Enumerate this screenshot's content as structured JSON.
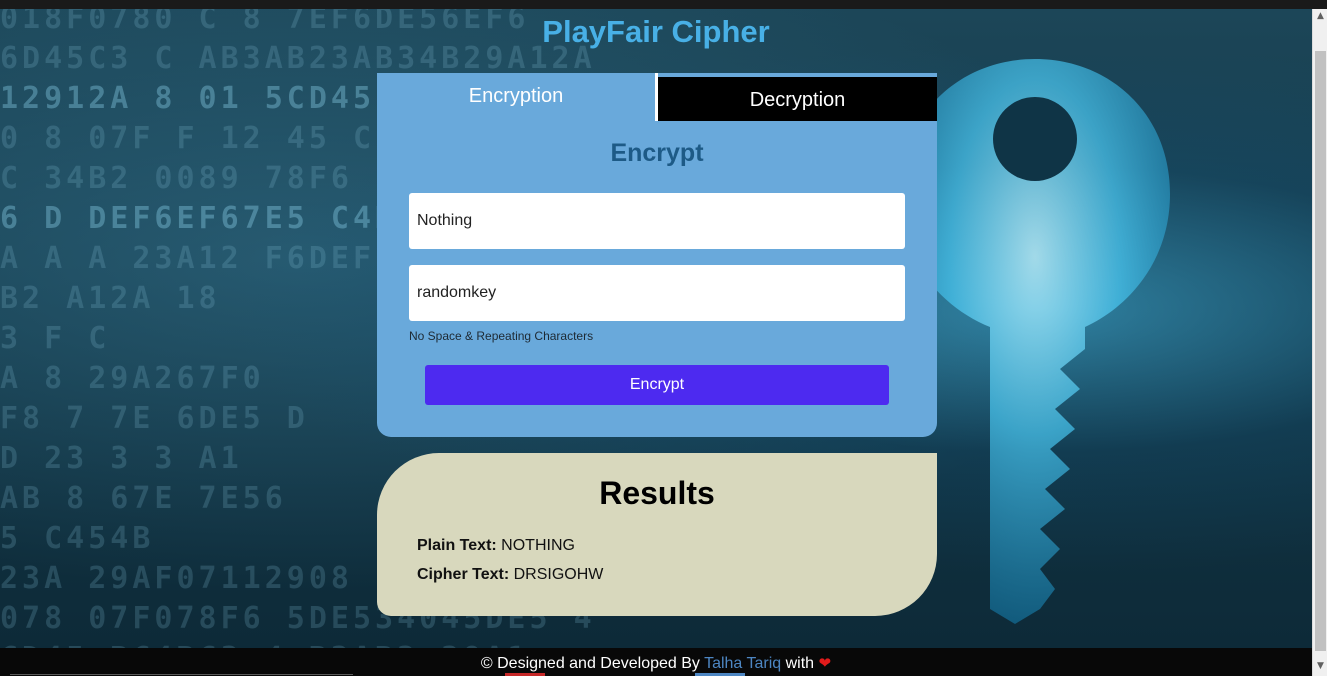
{
  "app": {
    "title": "PlayFair Cipher"
  },
  "tabs": [
    {
      "label": "Encryption",
      "active": true
    },
    {
      "label": "Decryption",
      "active": false
    }
  ],
  "form": {
    "heading": "Encrypt",
    "plaintext_value": "Nothing",
    "key_value": "randomkey",
    "hint": "No Space & Repeating Characters",
    "submit_label": "Encrypt"
  },
  "results": {
    "heading": "Results",
    "plain_label": "Plain Text:",
    "plain_value": "NOTHING",
    "cipher_label": "Cipher Text:",
    "cipher_value": "DRSIGOHW"
  },
  "footer": {
    "prefix": "© Designed and Developed By",
    "author": "Talha Tariq",
    "suffix": "with",
    "heart_icon": "heart-icon"
  },
  "colors": {
    "title": "#48b0e6",
    "card": "#69a9db",
    "button": "#4d2af0",
    "results_bg": "#d8d8bd",
    "author_link": "#4d86c2",
    "heart": "#e21b1b"
  }
}
